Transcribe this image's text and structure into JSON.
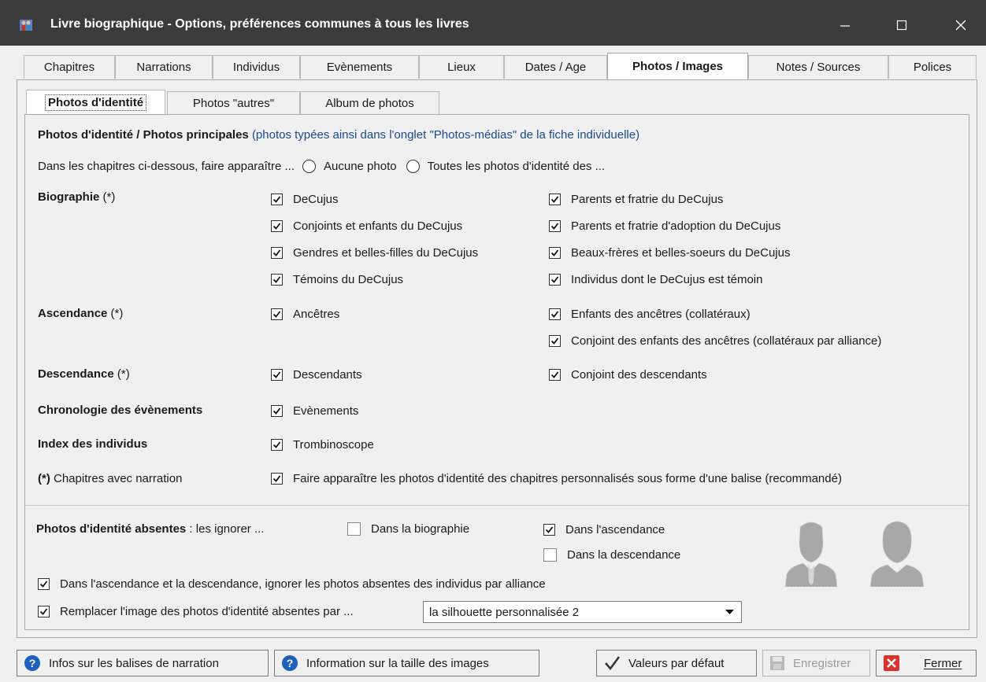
{
  "window": {
    "title": "Livre biographique - Options, préférences communes à tous les livres"
  },
  "tabs": [
    "Chapitres",
    "Narrations",
    "Individus",
    "Evènements",
    "Lieux",
    "Dates / Age",
    "Photos / Images",
    "Notes / Sources",
    "Polices"
  ],
  "active_tab": "Photos / Images",
  "subtabs": [
    "Photos d'identité",
    "Photos \"autres\"",
    "Album de photos"
  ],
  "active_subtab": "Photos d'identité",
  "header": {
    "title": "Photos d'identité / Photos principales",
    "note": "(photos typées ainsi dans l'onglet \"Photos-médias\" de la fiche individuelle)"
  },
  "display_line": {
    "prompt": "Dans les chapitres ci-dessous, faire apparaître ...",
    "radio_none": "Aucune photo",
    "radio_all": "Toutes les photos d'identité des ..."
  },
  "sections": {
    "biographie": {
      "label": "Biographie",
      "suffix": "(*)"
    },
    "ascendance": {
      "label": "Ascendance",
      "suffix": "(*)"
    },
    "descendance": {
      "label": "Descendance",
      "suffix": "(*)"
    },
    "chronologie": {
      "label": "Chronologie des évènements"
    },
    "index": {
      "label": "Index des individus"
    },
    "narration": {
      "prefix": "(*)",
      "label": "Chapitres avec narration"
    }
  },
  "checks": {
    "decujus": "DeCujus",
    "conjoints": "Conjoints et enfants du DeCujus",
    "gendres": "Gendres et belles-filles du DeCujus",
    "temoins": "Témoins du DeCujus",
    "parents": "Parents et fratrie du DeCujus",
    "parents_adoption": "Parents et fratrie d'adoption du DeCujus",
    "beaux_freres": "Beaux-frères et belles-soeurs du DeCujus",
    "individus_temoin": "Individus dont le DeCujus est témoin",
    "ancetres": "Ancêtres",
    "enfants_ancetres": "Enfants des ancêtres (collatéraux)",
    "conjoint_enfants_ancetres": "Conjoint des enfants des ancêtres (collatéraux par alliance)",
    "descendants": "Descendants",
    "conjoint_descendants": "Conjoint des descendants",
    "evenements": "Evènements",
    "trombinoscope": "Trombinoscope",
    "narration_balise": "Faire apparaître les photos d'identité des chapitres personnalisés sous forme d'une balise (recommandé)"
  },
  "absent": {
    "label": "Photos d'identité absentes",
    "label_suffix": " : les ignorer ...",
    "biographie": "Dans la biographie",
    "ascendance": "Dans l'ascendance",
    "descendance": "Dans la descendance",
    "alliance": "Dans l'ascendance et la descendance, ignorer les photos absentes des individus par alliance",
    "replace": "Remplacer l'image des photos d'identité absentes par ...",
    "replace_value": "la silhouette personnalisée 2"
  },
  "buttons": {
    "infos_balises": "Infos sur les balises de narration",
    "info_taille": "Information sur la taille des images",
    "defaults": "Valeurs par défaut",
    "save": "Enregistrer",
    "close": "Fermer"
  },
  "colors": {
    "titlebar": "#3b3b3b",
    "note_blue": "#1a4a8c",
    "help_blue": "#1f5fbf",
    "close_red": "#d9342b"
  }
}
